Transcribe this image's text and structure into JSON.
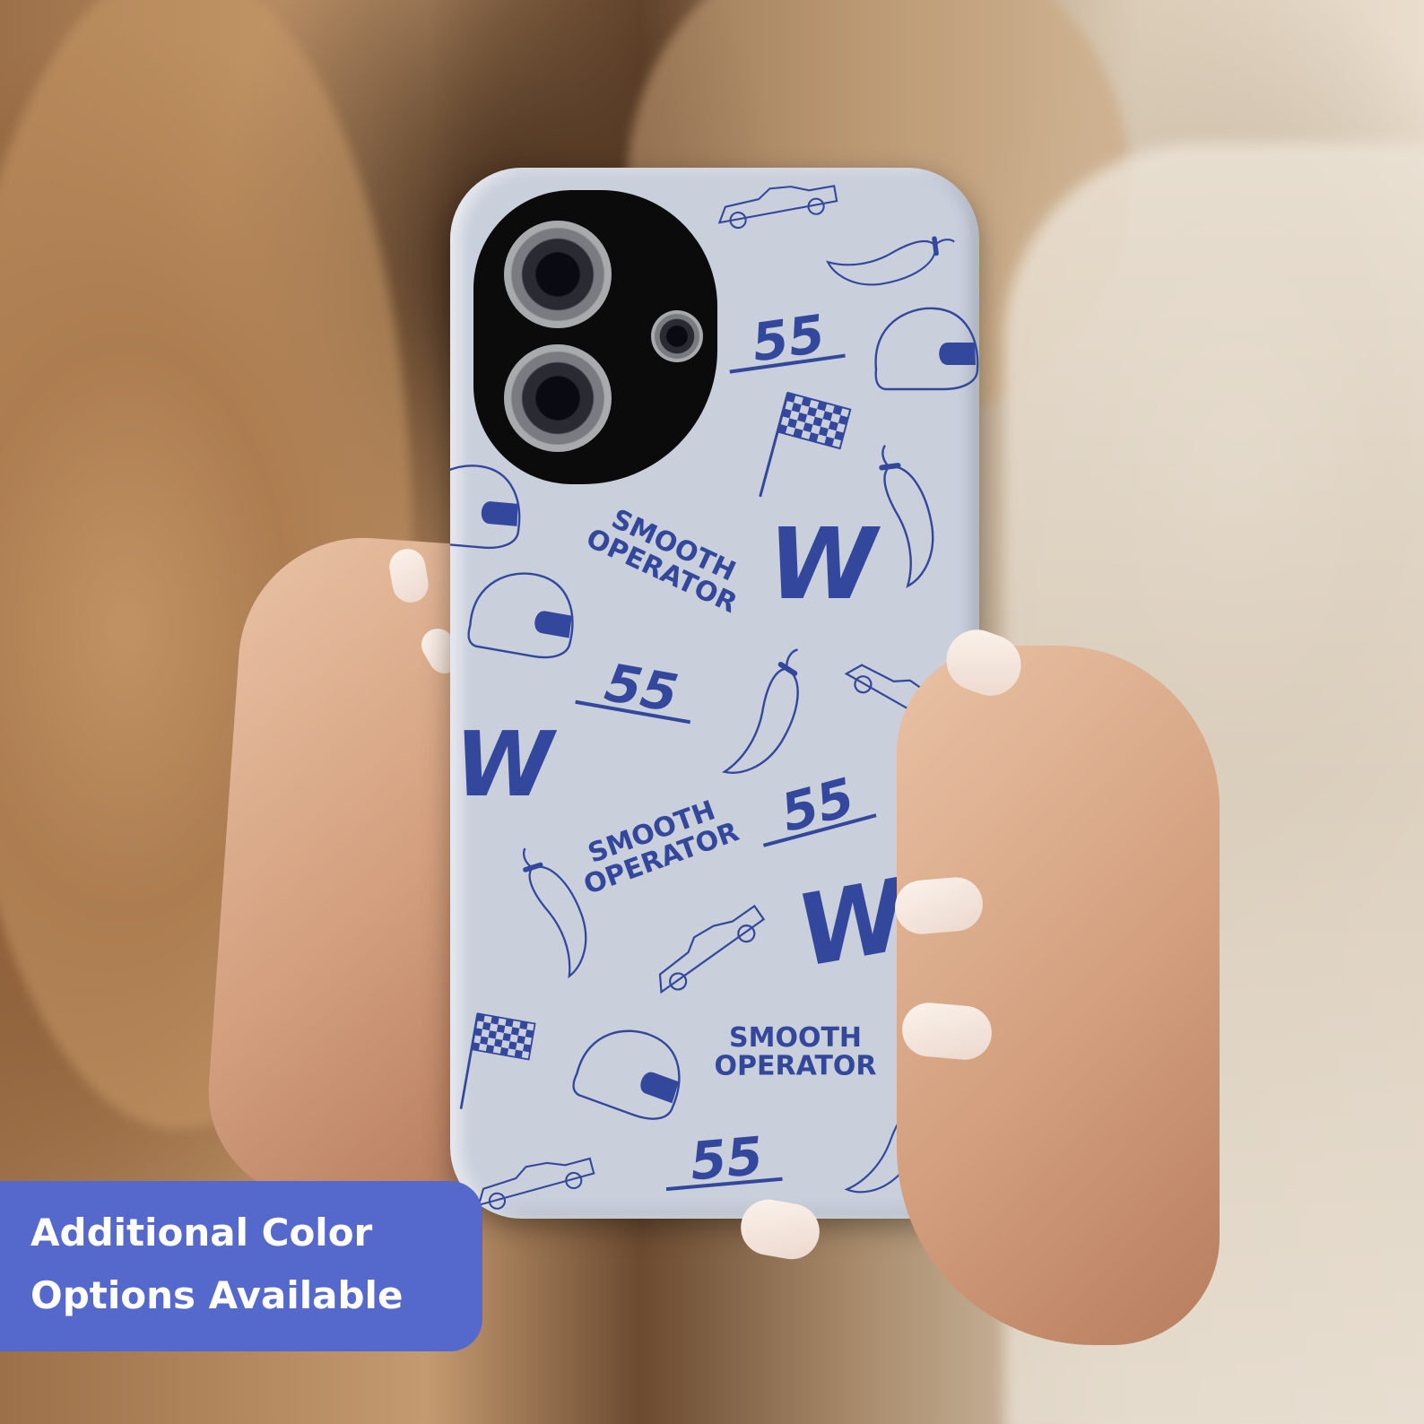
{
  "badge": {
    "line1": "Additional Color",
    "line2": "Options Available"
  },
  "case_pattern": {
    "text_motif": "SMOOTH OPERATOR",
    "number_motif": "55",
    "letter_motif": "W",
    "motif_color": "#33489c",
    "case_color": "#c9cfdb"
  },
  "colors": {
    "badge_background": "#5568cc",
    "badge_text": "#ffffff"
  },
  "icons": [
    "helmet-icon",
    "race-car-icon",
    "chili-pepper-icon",
    "checkered-flag-icon"
  ]
}
